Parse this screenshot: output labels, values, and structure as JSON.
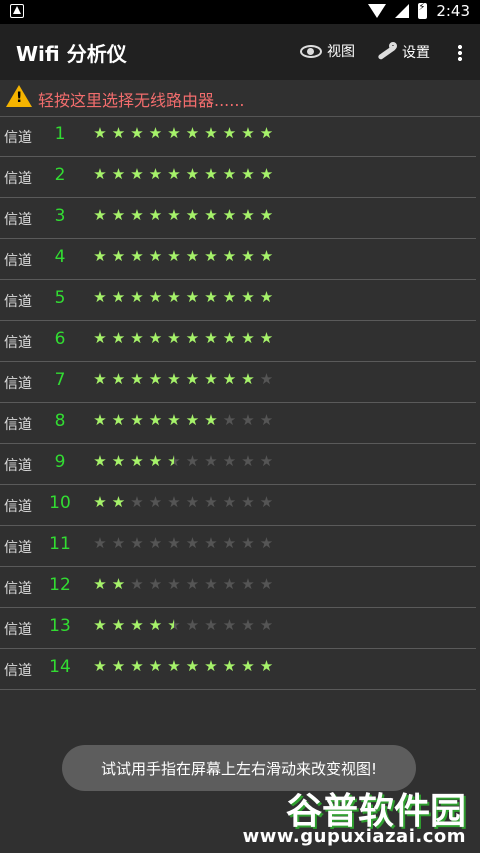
{
  "statusbar": {
    "time": "2:43"
  },
  "appbar": {
    "title": "Wifi 分析仪",
    "view_label": "视图",
    "settings_label": "设置"
  },
  "router": {
    "prompt": "轻按这里选择无线路由器......"
  },
  "channels": [
    {
      "label": "信道",
      "number": "1",
      "rating": 10
    },
    {
      "label": "信道",
      "number": "2",
      "rating": 10
    },
    {
      "label": "信道",
      "number": "3",
      "rating": 10
    },
    {
      "label": "信道",
      "number": "4",
      "rating": 10
    },
    {
      "label": "信道",
      "number": "5",
      "rating": 10
    },
    {
      "label": "信道",
      "number": "6",
      "rating": 10
    },
    {
      "label": "信道",
      "number": "7",
      "rating": 9
    },
    {
      "label": "信道",
      "number": "8",
      "rating": 7
    },
    {
      "label": "信道",
      "number": "9",
      "rating": 4.5
    },
    {
      "label": "信道",
      "number": "10",
      "rating": 2
    },
    {
      "label": "信道",
      "number": "11",
      "rating": 0
    },
    {
      "label": "信道",
      "number": "12",
      "rating": 2
    },
    {
      "label": "信道",
      "number": "13",
      "rating": 4.5
    },
    {
      "label": "信道",
      "number": "14",
      "rating": 10
    }
  ],
  "max_stars": 10,
  "toast": {
    "text": "试试用手指在屏幕上左右滑动来改变视图!"
  },
  "watermark": {
    "brand": "谷普软件园",
    "url": "www.gupuxiazai.com"
  },
  "colors": {
    "channel_number": "#32dc32",
    "star_full": "#a6f26a",
    "star_empty": "#555555",
    "router_text": "#f26d6d"
  }
}
